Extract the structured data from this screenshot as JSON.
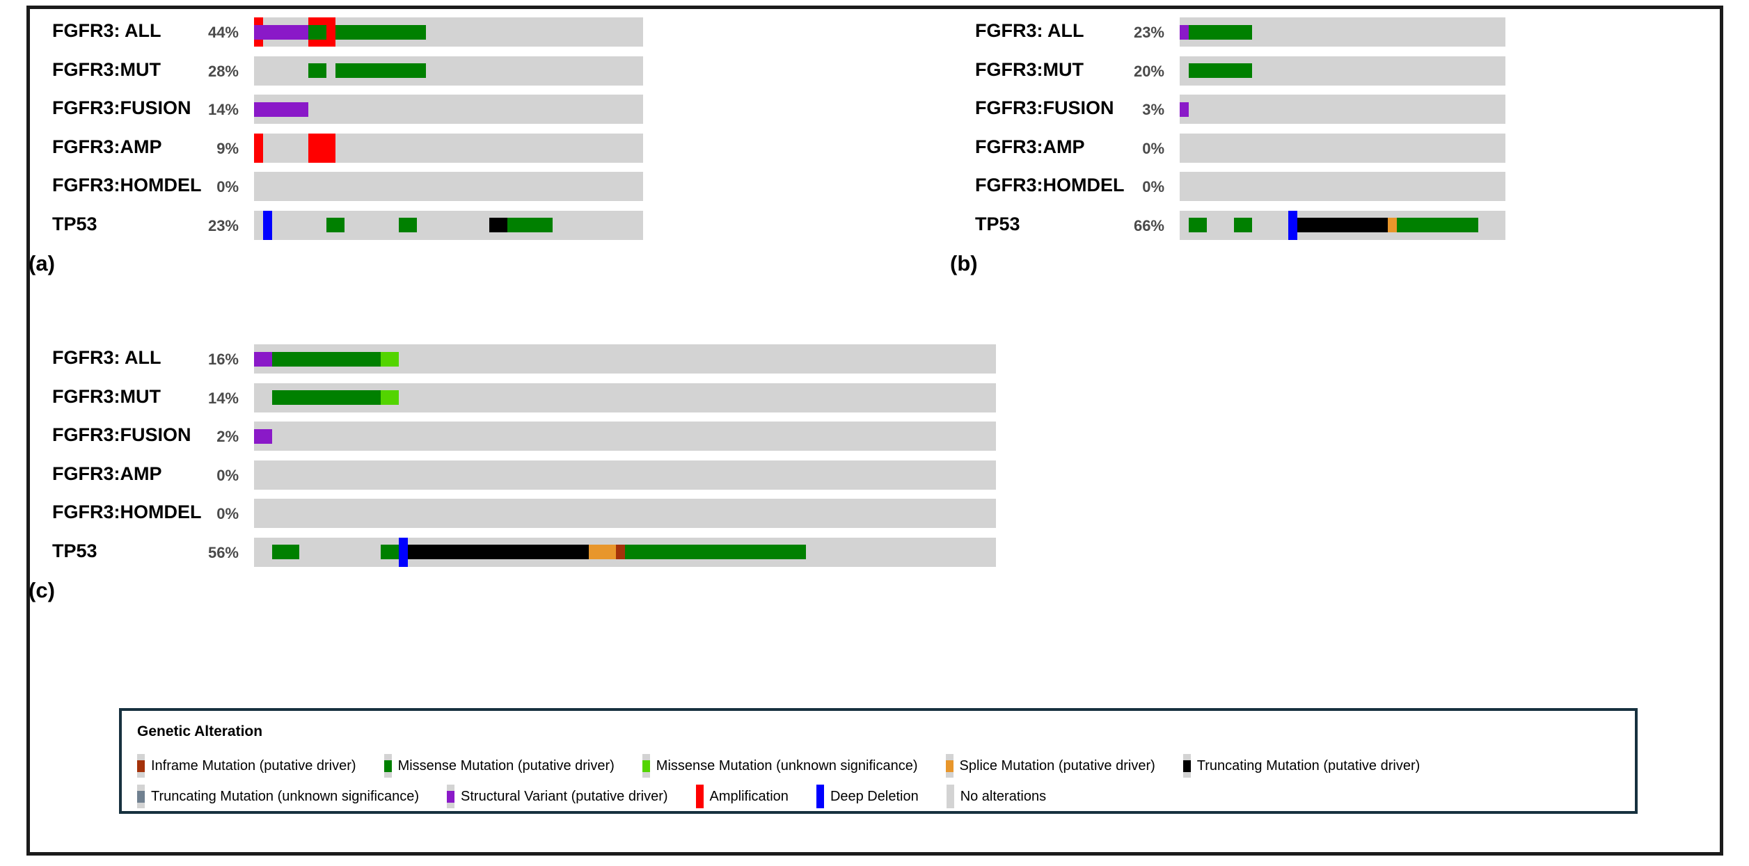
{
  "figure": {
    "type": "oncoprint",
    "panels": [
      "a",
      "b",
      "c"
    ]
  },
  "colors": {
    "background": "#d3d3d3",
    "inframe_driver": "#a4320a",
    "missense_driver": "#008000",
    "missense_unknown": "#53d400",
    "splice_driver": "#e8962b",
    "truncating_driver": "#000000",
    "truncating_unknown": "#708090",
    "structural_variant": "#8a19c8",
    "amplification": "#ff0000",
    "deep_deletion": "#0000ff",
    "no_alterations": "#d3d3d3",
    "border": "#1b1b1b",
    "legend_border": "#17313f",
    "pct_text": "#4a4a4a"
  },
  "panel_a": {
    "tag": "(a)",
    "columns": 43,
    "rows": [
      {
        "gene": "FGFR3: ALL",
        "pct": "44%",
        "cells": [
          {
            "i": 0,
            "full": "amplification",
            "inner": "structural_variant"
          },
          {
            "i": 1,
            "inner": "structural_variant"
          },
          {
            "i": 2,
            "inner": "structural_variant"
          },
          {
            "i": 3,
            "inner": "structural_variant"
          },
          {
            "i": 4,
            "inner": "structural_variant"
          },
          {
            "i": 5,
            "inner": "structural_variant"
          },
          {
            "i": 6,
            "full": "amplification",
            "inner": "missense_driver"
          },
          {
            "i": 7,
            "full": "amplification",
            "inner": "missense_driver"
          },
          {
            "i": 8,
            "full": "amplification"
          },
          {
            "i": 9,
            "inner": "missense_driver"
          },
          {
            "i": 10,
            "inner": "missense_driver"
          },
          {
            "i": 11,
            "inner": "missense_driver"
          },
          {
            "i": 12,
            "inner": "missense_driver"
          },
          {
            "i": 13,
            "inner": "missense_driver"
          },
          {
            "i": 14,
            "inner": "missense_driver"
          },
          {
            "i": 15,
            "inner": "missense_driver"
          },
          {
            "i": 16,
            "inner": "missense_driver"
          },
          {
            "i": 17,
            "inner": "missense_driver"
          },
          {
            "i": 18,
            "inner": "missense_driver"
          }
        ]
      },
      {
        "gene": "FGFR3:MUT",
        "pct": "28%",
        "cells": [
          {
            "i": 6,
            "inner": "missense_driver"
          },
          {
            "i": 7,
            "inner": "missense_driver"
          },
          {
            "i": 9,
            "inner": "missense_driver"
          },
          {
            "i": 10,
            "inner": "missense_driver"
          },
          {
            "i": 11,
            "inner": "missense_driver"
          },
          {
            "i": 12,
            "inner": "missense_driver"
          },
          {
            "i": 13,
            "inner": "missense_driver"
          },
          {
            "i": 14,
            "inner": "missense_driver"
          },
          {
            "i": 15,
            "inner": "missense_driver"
          },
          {
            "i": 16,
            "inner": "missense_driver"
          },
          {
            "i": 17,
            "inner": "missense_driver"
          },
          {
            "i": 18,
            "inner": "missense_driver"
          }
        ]
      },
      {
        "gene": "FGFR3:FUSION",
        "pct": "14%",
        "cells": [
          {
            "i": 0,
            "inner": "structural_variant"
          },
          {
            "i": 1,
            "inner": "structural_variant"
          },
          {
            "i": 2,
            "inner": "structural_variant"
          },
          {
            "i": 3,
            "inner": "structural_variant"
          },
          {
            "i": 4,
            "inner": "structural_variant"
          },
          {
            "i": 5,
            "inner": "structural_variant"
          }
        ]
      },
      {
        "gene": "FGFR3:AMP",
        "pct": "9%",
        "cells": [
          {
            "i": 0,
            "full": "amplification"
          },
          {
            "i": 6,
            "full": "amplification"
          },
          {
            "i": 7,
            "full": "amplification"
          },
          {
            "i": 8,
            "full": "amplification"
          }
        ]
      },
      {
        "gene": "FGFR3:HOMDEL",
        "pct": "0%",
        "cells": []
      },
      {
        "gene": "TP53",
        "pct": "23%",
        "plain": true,
        "cells": [
          {
            "i": 1,
            "full": "deep_deletion"
          },
          {
            "i": 8,
            "inner": "missense_driver"
          },
          {
            "i": 9,
            "inner": "missense_driver"
          },
          {
            "i": 16,
            "inner": "missense_driver"
          },
          {
            "i": 17,
            "inner": "missense_driver"
          },
          {
            "i": 26,
            "inner": "truncating_driver"
          },
          {
            "i": 27,
            "inner": "truncating_driver"
          },
          {
            "i": 28,
            "inner": "missense_driver"
          },
          {
            "i": 29,
            "inner": "missense_driver"
          },
          {
            "i": 30,
            "inner": "missense_driver"
          },
          {
            "i": 31,
            "inner": "missense_driver"
          },
          {
            "i": 32,
            "inner": "missense_driver"
          }
        ]
      }
    ]
  },
  "panel_b": {
    "tag": "(b)",
    "columns": 36,
    "rows": [
      {
        "gene": "FGFR3: ALL",
        "pct": "23%",
        "cells": [
          {
            "i": 0,
            "inner": "structural_variant"
          },
          {
            "i": 1,
            "inner": "missense_driver"
          },
          {
            "i": 2,
            "inner": "missense_driver"
          },
          {
            "i": 3,
            "inner": "missense_driver"
          },
          {
            "i": 4,
            "inner": "missense_driver"
          },
          {
            "i": 5,
            "inner": "missense_driver"
          },
          {
            "i": 6,
            "inner": "missense_driver"
          },
          {
            "i": 7,
            "inner": "missense_driver"
          }
        ]
      },
      {
        "gene": "FGFR3:MUT",
        "pct": "20%",
        "cells": [
          {
            "i": 1,
            "inner": "missense_driver"
          },
          {
            "i": 2,
            "inner": "missense_driver"
          },
          {
            "i": 3,
            "inner": "missense_driver"
          },
          {
            "i": 4,
            "inner": "missense_driver"
          },
          {
            "i": 5,
            "inner": "missense_driver"
          },
          {
            "i": 6,
            "inner": "missense_driver"
          },
          {
            "i": 7,
            "inner": "missense_driver"
          }
        ]
      },
      {
        "gene": "FGFR3:FUSION",
        "pct": "3%",
        "cells": [
          {
            "i": 0,
            "inner": "structural_variant"
          }
        ]
      },
      {
        "gene": "FGFR3:AMP",
        "pct": "0%",
        "cells": []
      },
      {
        "gene": "FGFR3:HOMDEL",
        "pct": "0%",
        "cells": []
      },
      {
        "gene": "TP53",
        "pct": "66%",
        "plain": true,
        "cells": [
          {
            "i": 1,
            "inner": "missense_driver"
          },
          {
            "i": 2,
            "inner": "missense_driver"
          },
          {
            "i": 6,
            "inner": "missense_driver"
          },
          {
            "i": 7,
            "inner": "missense_driver"
          },
          {
            "i": 12,
            "full": "deep_deletion"
          },
          {
            "i": 13,
            "inner": "truncating_driver"
          },
          {
            "i": 14,
            "inner": "truncating_driver"
          },
          {
            "i": 15,
            "inner": "truncating_driver"
          },
          {
            "i": 16,
            "inner": "truncating_driver"
          },
          {
            "i": 17,
            "inner": "truncating_driver"
          },
          {
            "i": 18,
            "inner": "truncating_driver"
          },
          {
            "i": 19,
            "inner": "truncating_driver"
          },
          {
            "i": 20,
            "inner": "truncating_driver"
          },
          {
            "i": 21,
            "inner": "truncating_driver"
          },
          {
            "i": 22,
            "inner": "truncating_driver"
          },
          {
            "i": 23,
            "inner": "splice_driver"
          },
          {
            "i": 24,
            "inner": "missense_driver"
          },
          {
            "i": 25,
            "inner": "missense_driver"
          },
          {
            "i": 26,
            "inner": "missense_driver"
          },
          {
            "i": 27,
            "inner": "missense_driver"
          },
          {
            "i": 28,
            "inner": "missense_driver"
          },
          {
            "i": 29,
            "inner": "missense_driver"
          },
          {
            "i": 30,
            "inner": "missense_driver"
          },
          {
            "i": 31,
            "inner": "missense_driver"
          },
          {
            "i": 32,
            "inner": "missense_driver"
          }
        ]
      }
    ]
  },
  "panel_c": {
    "tag": "(c)",
    "columns": 82,
    "rows": [
      {
        "gene": "FGFR3: ALL",
        "pct": "16%",
        "cells": [
          {
            "i": 0,
            "inner": "structural_variant"
          },
          {
            "i": 1,
            "inner": "structural_variant"
          },
          {
            "i": 2,
            "inner": "missense_driver"
          },
          {
            "i": 3,
            "inner": "missense_driver"
          },
          {
            "i": 4,
            "inner": "missense_driver"
          },
          {
            "i": 5,
            "inner": "missense_driver"
          },
          {
            "i": 6,
            "inner": "missense_driver"
          },
          {
            "i": 7,
            "inner": "missense_driver"
          },
          {
            "i": 8,
            "inner": "missense_driver"
          },
          {
            "i": 9,
            "inner": "missense_driver"
          },
          {
            "i": 10,
            "inner": "missense_driver"
          },
          {
            "i": 11,
            "inner": "missense_driver"
          },
          {
            "i": 12,
            "inner": "missense_driver"
          },
          {
            "i": 13,
            "inner": "missense_driver"
          },
          {
            "i": 14,
            "inner": "missense_unknown"
          },
          {
            "i": 15,
            "inner": "missense_unknown"
          }
        ]
      },
      {
        "gene": "FGFR3:MUT",
        "pct": "14%",
        "cells": [
          {
            "i": 2,
            "inner": "missense_driver"
          },
          {
            "i": 3,
            "inner": "missense_driver"
          },
          {
            "i": 4,
            "inner": "missense_driver"
          },
          {
            "i": 5,
            "inner": "missense_driver"
          },
          {
            "i": 6,
            "inner": "missense_driver"
          },
          {
            "i": 7,
            "inner": "missense_driver"
          },
          {
            "i": 8,
            "inner": "missense_driver"
          },
          {
            "i": 9,
            "inner": "missense_driver"
          },
          {
            "i": 10,
            "inner": "missense_driver"
          },
          {
            "i": 11,
            "inner": "missense_driver"
          },
          {
            "i": 12,
            "inner": "missense_driver"
          },
          {
            "i": 13,
            "inner": "missense_driver"
          },
          {
            "i": 14,
            "inner": "missense_unknown"
          },
          {
            "i": 15,
            "inner": "missense_unknown"
          }
        ]
      },
      {
        "gene": "FGFR3:FUSION",
        "pct": "2%",
        "cells": [
          {
            "i": 0,
            "inner": "structural_variant"
          },
          {
            "i": 1,
            "inner": "structural_variant"
          }
        ]
      },
      {
        "gene": "FGFR3:AMP",
        "pct": "0%",
        "cells": []
      },
      {
        "gene": "FGFR3:HOMDEL",
        "pct": "0%",
        "cells": []
      },
      {
        "gene": "TP53",
        "pct": "56%",
        "plain": true,
        "cells": [
          {
            "i": 2,
            "inner": "missense_driver"
          },
          {
            "i": 3,
            "inner": "missense_driver"
          },
          {
            "i": 4,
            "inner": "missense_driver"
          },
          {
            "i": 14,
            "inner": "missense_driver"
          },
          {
            "i": 15,
            "inner": "missense_driver"
          },
          {
            "i": 16,
            "full": "deep_deletion"
          },
          {
            "i": 17,
            "inner": "truncating_driver"
          },
          {
            "i": 18,
            "inner": "truncating_driver"
          },
          {
            "i": 19,
            "inner": "truncating_driver"
          },
          {
            "i": 20,
            "inner": "truncating_driver"
          },
          {
            "i": 21,
            "inner": "truncating_driver"
          },
          {
            "i": 22,
            "inner": "truncating_driver"
          },
          {
            "i": 23,
            "inner": "truncating_driver"
          },
          {
            "i": 24,
            "inner": "truncating_driver"
          },
          {
            "i": 25,
            "inner": "truncating_driver"
          },
          {
            "i": 26,
            "inner": "truncating_driver"
          },
          {
            "i": 27,
            "inner": "truncating_driver"
          },
          {
            "i": 28,
            "inner": "truncating_driver"
          },
          {
            "i": 29,
            "inner": "truncating_driver"
          },
          {
            "i": 30,
            "inner": "truncating_driver"
          },
          {
            "i": 31,
            "inner": "truncating_driver"
          },
          {
            "i": 32,
            "inner": "truncating_driver"
          },
          {
            "i": 33,
            "inner": "truncating_driver"
          },
          {
            "i": 34,
            "inner": "truncating_driver"
          },
          {
            "i": 35,
            "inner": "truncating_driver"
          },
          {
            "i": 36,
            "inner": "truncating_driver"
          },
          {
            "i": 37,
            "inner": "splice_driver"
          },
          {
            "i": 38,
            "inner": "splice_driver"
          },
          {
            "i": 39,
            "inner": "splice_driver"
          },
          {
            "i": 40,
            "inner": "inframe_driver"
          },
          {
            "i": 41,
            "inner": "missense_driver"
          },
          {
            "i": 42,
            "inner": "missense_driver"
          },
          {
            "i": 43,
            "inner": "missense_driver"
          },
          {
            "i": 44,
            "inner": "missense_driver"
          },
          {
            "i": 45,
            "inner": "missense_driver"
          },
          {
            "i": 46,
            "inner": "missense_driver"
          },
          {
            "i": 47,
            "inner": "missense_driver"
          },
          {
            "i": 48,
            "inner": "missense_driver"
          },
          {
            "i": 49,
            "inner": "missense_driver"
          },
          {
            "i": 50,
            "inner": "missense_driver"
          },
          {
            "i": 51,
            "inner": "missense_driver"
          },
          {
            "i": 52,
            "inner": "missense_driver"
          },
          {
            "i": 53,
            "inner": "missense_driver"
          },
          {
            "i": 54,
            "inner": "missense_driver"
          },
          {
            "i": 55,
            "inner": "missense_driver"
          },
          {
            "i": 56,
            "inner": "missense_driver"
          },
          {
            "i": 57,
            "inner": "missense_driver"
          },
          {
            "i": 58,
            "inner": "missense_driver"
          },
          {
            "i": 59,
            "inner": "missense_driver"
          },
          {
            "i": 60,
            "inner": "missense_driver"
          }
        ]
      }
    ]
  },
  "legend": {
    "title": "Genetic Alteration",
    "rows": [
      [
        {
          "label": "Inframe Mutation (putative driver)",
          "color_key": "inframe_driver",
          "style": "inner"
        },
        {
          "label": "Missense Mutation (putative driver)",
          "color_key": "missense_driver",
          "style": "inner"
        },
        {
          "label": "Missense Mutation (unknown significance)",
          "color_key": "missense_unknown",
          "style": "inner"
        },
        {
          "label": "Splice Mutation (putative driver)",
          "color_key": "splice_driver",
          "style": "inner"
        },
        {
          "label": "Truncating Mutation (putative driver)",
          "color_key": "truncating_driver",
          "style": "inner"
        }
      ],
      [
        {
          "label": "Truncating Mutation (unknown significance)",
          "color_key": "truncating_unknown",
          "style": "inner"
        },
        {
          "label": "Structural Variant (putative driver)",
          "color_key": "structural_variant",
          "style": "inner"
        },
        {
          "label": "Amplification",
          "color_key": "amplification",
          "style": "full"
        },
        {
          "label": "Deep Deletion",
          "color_key": "deep_deletion",
          "style": "full"
        },
        {
          "label": "No alterations",
          "color_key": "no_alterations",
          "style": "none"
        }
      ]
    ]
  }
}
